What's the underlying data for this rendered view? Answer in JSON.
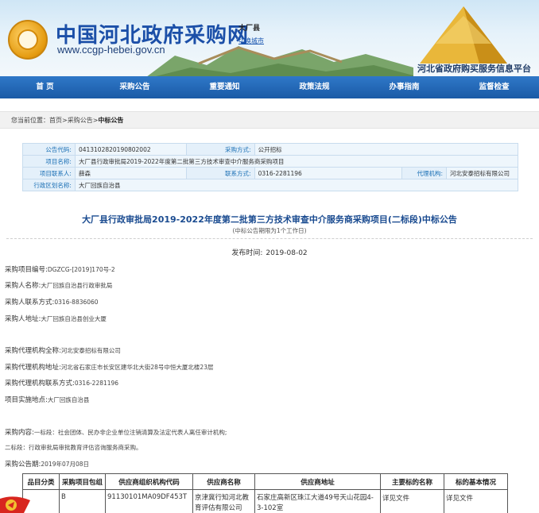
{
  "header": {
    "site_name": "中国河北政府采购网",
    "site_url": "www.ccgp-hebei.gov.cn",
    "region": "大厂县",
    "switch_city": "切换城市",
    "platform": "河北省政府购买服务信息平台"
  },
  "nav": {
    "items": [
      "首 页",
      "采购公告",
      "重要通知",
      "政策法规",
      "办事指南",
      "监督检查"
    ]
  },
  "breadcrumb": {
    "prefix": "您当前位置：",
    "home": "首页",
    "sep1": ">",
    "section": "采购公告",
    "sep2": ">",
    "current": "中标公告"
  },
  "info": {
    "code_label": "公告代码:",
    "code_value": "0413102820190802002",
    "method_label": "采购方式:",
    "method_value": "公开招标",
    "project_label": "项目名称:",
    "project_value": "大厂县行政审批局2019-2022年度第二批第三方技术审查中介服务商采购项目",
    "contact_label": "项目联系人:",
    "contact_value": "薛森",
    "phone_label": "联系方式:",
    "phone_value": "0316-2281196",
    "agency_label": "代理机构:",
    "agency_value": "河北安泰招标有限公司",
    "district_label": "行政区划名称:",
    "district_value": "大厂回族自治县"
  },
  "article": {
    "title": "大厂县行政审批局2019-2022年度第二批第三方技术审查中介服务商采购项目(二标段)中标公告",
    "subtitle": "(中标公告期限为1个工作日)",
    "pub_label": "发布时间:",
    "pub_date": "2019-08-02",
    "lines": [
      {
        "label": "采购项目编号:",
        "value": "DGZCG-[2019]170号-2"
      },
      {
        "label": "采购人名称:",
        "value": "大厂回族自治县行政审批局"
      },
      {
        "label": "采购人联系方式:",
        "value": "0316-8836060"
      },
      {
        "label": "采购人地址:",
        "value": "大厂回族自治县创业大厦"
      },
      {
        "label": "采购代理机构全称:",
        "value": "河北安泰招标有限公司"
      },
      {
        "label": "采购代理机构地址:",
        "value": "河北省石家庄市长安区建华北大街28号中恒大厦北楼23层"
      },
      {
        "label": "采购代理机构联系方式:",
        "value": "0316-2281196"
      },
      {
        "label": "项目实施地点:",
        "value": "大厂回族自治县"
      },
      {
        "label": "采购内容:",
        "value": "一标段：社会团体、民办非企业单位注销清算及法定代表人离任审计机构;"
      },
      {
        "label": "",
        "value": "二标段：行政审批局审批教育评估咨询服务商采购。"
      },
      {
        "label": "采购公告期:",
        "value": "2019年07月08日"
      }
    ]
  },
  "result_table": {
    "headers": [
      "品目分类",
      "采购项目包组",
      "供应商组织机构代码",
      "供应商名称",
      "供应商地址",
      "主要标的名称",
      "标的基本情况"
    ],
    "rows": [
      [
        "",
        "B",
        "91130101MA09DF453T",
        "京津冀行知河北教育评估有限公司",
        "石家庄高新区珠江大道49号天山花园4-3-102室",
        "详见文件",
        "详见文件"
      ]
    ]
  },
  "colors": {
    "nav_blue": "#1a5aa6",
    "link_blue": "#1a6fb5",
    "title_blue": "#1a4b90"
  }
}
